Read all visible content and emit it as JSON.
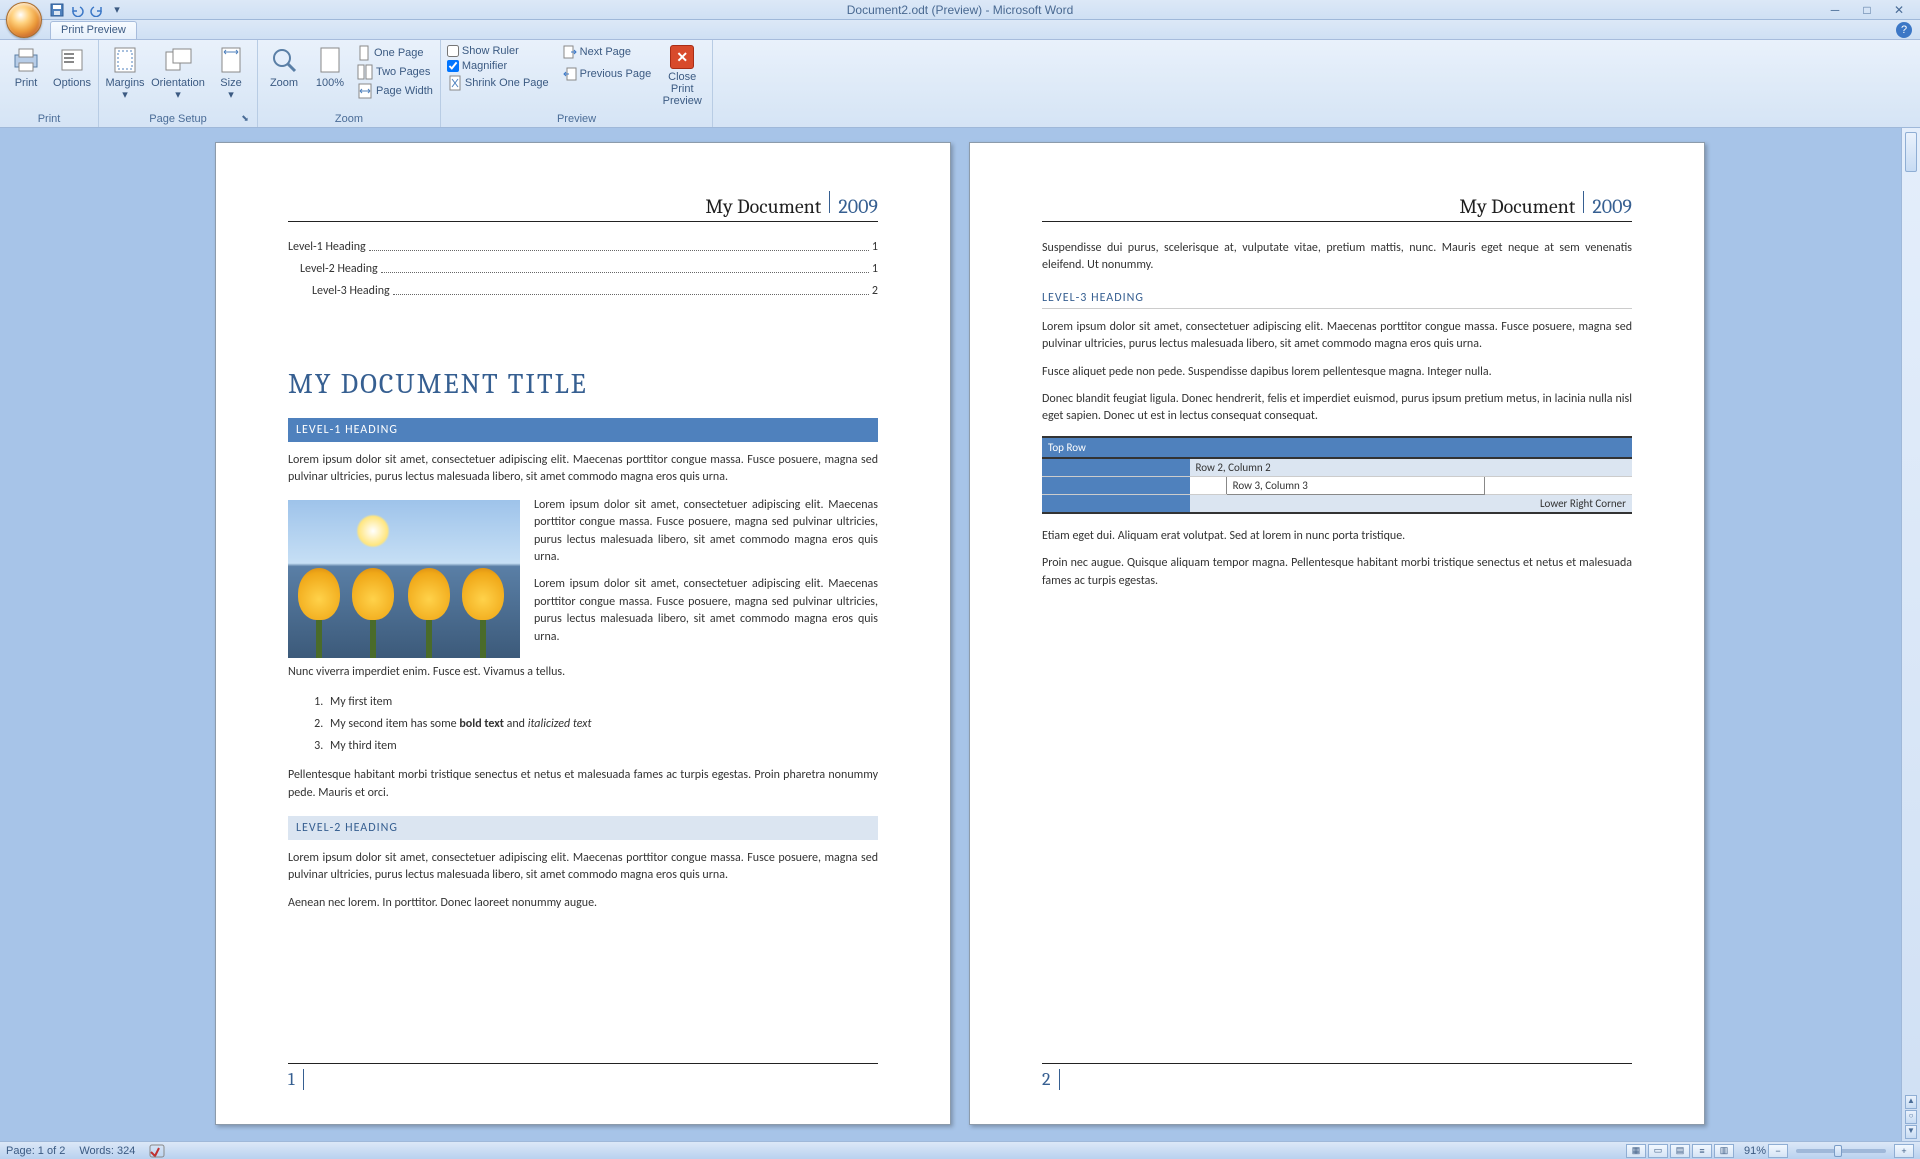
{
  "title": "Document2.odt (Preview) - Microsoft Word",
  "tab": {
    "printPreview": "Print Preview"
  },
  "ribbon": {
    "print": {
      "print": "Print",
      "options": "Options",
      "group": "Print"
    },
    "pageSetup": {
      "margins": "Margins",
      "orientation": "Orientation",
      "size": "Size",
      "group": "Page Setup"
    },
    "zoom": {
      "zoom": "Zoom",
      "pct": "100%",
      "onePage": "One Page",
      "twoPages": "Two Pages",
      "pageWidth": "Page Width",
      "group": "Zoom"
    },
    "preview": {
      "showRuler": "Show Ruler",
      "magnifier": "Magnifier",
      "shrink": "Shrink One Page",
      "next": "Next Page",
      "prev": "Previous Page",
      "close": "Close Print Preview",
      "group": "Preview"
    }
  },
  "doc": {
    "headerTitle": "My Document",
    "headerYear": "2009",
    "toc": {
      "l1": "Level-1 Heading",
      "l1p": "1",
      "l2": "Level-2 Heading",
      "l2p": "1",
      "l3": "Level-3 Heading",
      "l3p": "2"
    },
    "title": "MY DOCUMENT TITLE",
    "h1": "LEVEL-1 HEADING",
    "p1": "Lorem ipsum dolor sit amet, consectetuer adipiscing elit. Maecenas porttitor congue massa. Fusce posuere, magna sed pulvinar ultricies, purus lectus malesuada libero, sit amet commodo magna eros quis urna.",
    "p2": "Lorem ipsum dolor sit amet, consectetuer adipiscing elit. Maecenas porttitor congue massa. Fusce posuere, magna sed pulvinar ultricies, purus lectus malesuada libero, sit amet commodo magna eros quis urna.",
    "p3": "Lorem ipsum dolor sit amet, consectetuer adipiscing elit. Maecenas porttitor congue massa. Fusce posuere, magna sed pulvinar ultricies, purus lectus malesuada libero, sit amet commodo magna eros quis urna.",
    "p4": "Nunc viverra imperdiet enim. Fusce est. Vivamus a tellus.",
    "li1": "My first item",
    "li2a": "My second item has some ",
    "li2b": "bold text",
    "li2c": " and ",
    "li2d": "italicized text",
    "li3": "My third item",
    "p5": "Pellentesque habitant morbi tristique senectus et netus et malesuada fames ac turpis egestas. Proin pharetra nonummy pede. Mauris et orci.",
    "h2": "LEVEL-2 HEADING",
    "p6": "Lorem ipsum dolor sit amet, consectetuer adipiscing elit. Maecenas porttitor congue massa. Fusce posuere, magna sed pulvinar ultricies, purus lectus malesuada libero, sit amet commodo magna eros quis urna.",
    "p7": "Aenean nec lorem. In porttitor. Donec laoreet nonummy augue.",
    "pg1": "1",
    "p8": "Suspendisse dui purus, scelerisque at, vulputate vitae, pretium mattis, nunc. Mauris eget neque at sem venenatis eleifend. Ut nonummy.",
    "h3": "LEVEL-3 HEADING",
    "p9": "Lorem ipsum dolor sit amet, consectetuer adipiscing elit. Maecenas porttitor congue massa. Fusce posuere, magna sed pulvinar ultricies, purus lectus malesuada libero, sit amet commodo magna eros quis urna.",
    "p10": "Fusce aliquet pede non pede. Suspendisse dapibus lorem pellentesque magna. Integer nulla.",
    "p11": "Donec blandit feugiat ligula. Donec hendrerit, felis et imperdiet euismod, purus ipsum pretium metus, in lacinia nulla nisl eget sapien. Donec ut est in lectus consequat consequat.",
    "table": {
      "topRow": "Top Row",
      "r2c2": "Row 2, Column 2",
      "r3c3": "Row 3, Column 3",
      "lrc": "Lower Right Corner"
    },
    "p12": "Etiam eget dui. Aliquam erat volutpat. Sed at lorem in nunc porta tristique.",
    "p13": "Proin nec augue. Quisque aliquam tempor magna. Pellentesque habitant morbi tristique senectus et netus et malesuada fames ac turpis egestas.",
    "pg2": "2"
  },
  "status": {
    "page": "Page: 1 of 2",
    "words": "Words: 324",
    "zoom": "91%"
  }
}
